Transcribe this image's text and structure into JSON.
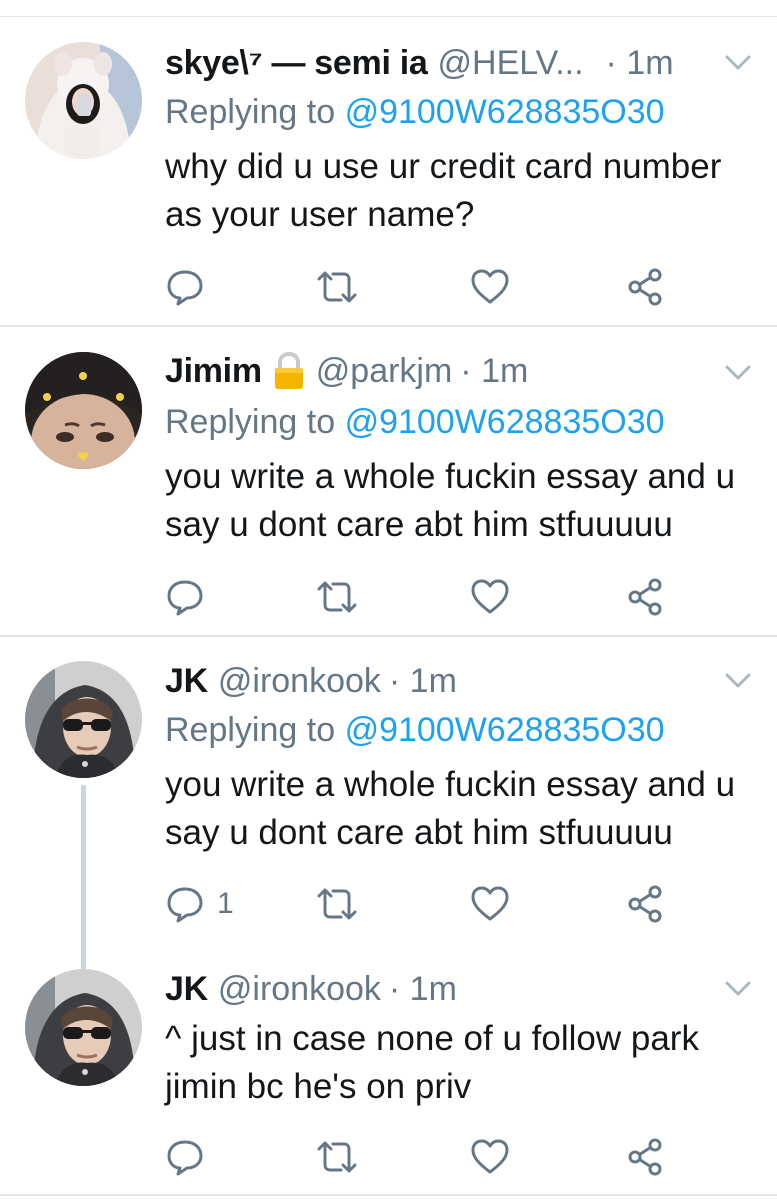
{
  "tweets": [
    {
      "name": "skye\\⁷ — semi ia",
      "handle": "@HELV...",
      "time": "· 1m",
      "locked": false,
      "reply_label": "Replying to",
      "reply_mention": "@9100W628835O30",
      "body": "why did u use ur credit card number as your user name?",
      "reply_count": "",
      "avatar_icon": "avatar-photo-hoodie"
    },
    {
      "name": "Jimim",
      "handle": "@parkjm",
      "time": "· 1m",
      "locked": true,
      "reply_label": "Replying to",
      "reply_mention": "@9100W628835O30",
      "body": "you write a whole fuckin essay and u say u dont care abt him stfuuuuu",
      "reply_count": "",
      "avatar_icon": "avatar-photo-face"
    },
    {
      "name": "JK",
      "handle": "@ironkook",
      "time": "· 1m",
      "locked": false,
      "reply_label": "Replying to",
      "reply_mention": "@9100W628835O30",
      "body": "you write a whole fuckin essay and u say u dont care abt him stfuuuuu",
      "reply_count": "1",
      "avatar_icon": "avatar-photo-sunglasses"
    },
    {
      "name": "JK",
      "handle": "@ironkook",
      "time": "· 1m",
      "locked": false,
      "body": "^ just in case none of u follow park jimin bc he's on priv",
      "reply_count": "",
      "avatar_icon": "avatar-photo-sunglasses"
    }
  ],
  "icons": {
    "reply": "reply-icon",
    "retweet": "retweet-icon",
    "like": "heart-icon",
    "share": "share-icon",
    "caret": "chevron-down-icon",
    "lock": "lock-icon"
  },
  "colors": {
    "link": "#1da1f2",
    "secondary": "#657786",
    "divider": "#e1e8ed",
    "thread_line": "#ccd6dd",
    "lock": "#f5b400"
  }
}
